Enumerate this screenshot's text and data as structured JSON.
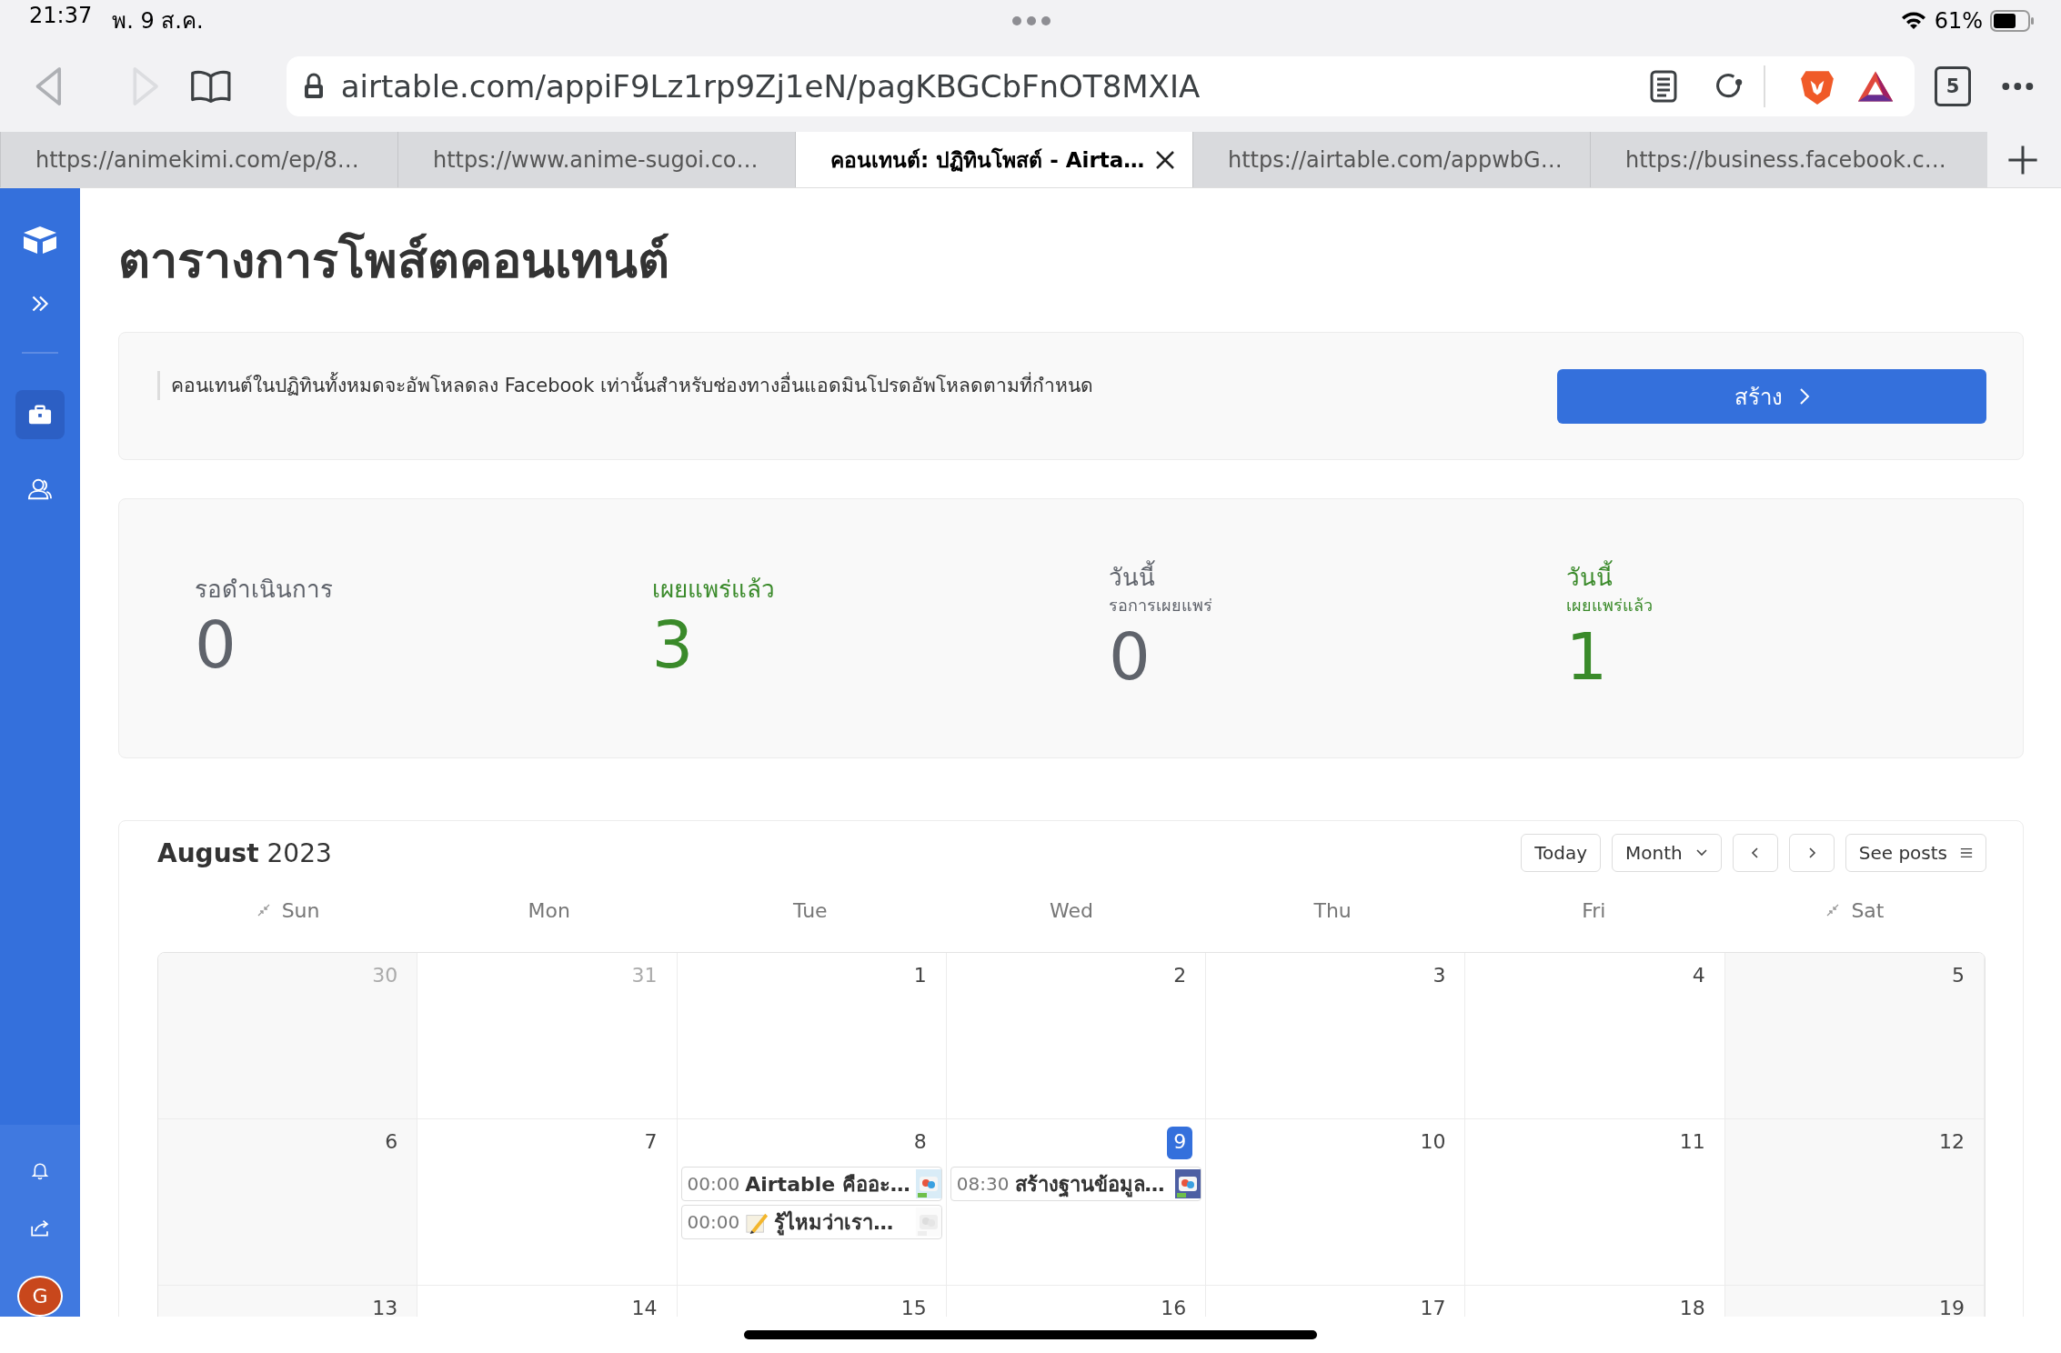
{
  "status_bar": {
    "time": "21:37",
    "date": "พ. 9 ส.ค.",
    "battery": "61%"
  },
  "browser": {
    "url": "airtable.com/appiF9Lz1rp9Zj1eN/pagKBGCbFnOT8MXIA",
    "back_disabled": false,
    "forward_disabled": true,
    "tab_count": "5",
    "tabs": [
      {
        "label": "https://animekimi.com/ep/8…",
        "selected": false
      },
      {
        "label": "https://www.anime-sugoi.co…",
        "selected": false
      },
      {
        "label": "คอนเทนต์: ปฏิทินโพสต์ - Airta…",
        "selected": true
      },
      {
        "label": "https://airtable.com/appwbG…",
        "selected": false
      },
      {
        "label": "https://business.facebook.c…",
        "selected": false
      }
    ]
  },
  "sidebar": {
    "items": [
      {
        "kind": "briefcase",
        "selected": true
      },
      {
        "kind": "people",
        "selected": false
      }
    ],
    "avatar": "G"
  },
  "page": {
    "title": "ตารางการโพส์ตคอนเทนต์",
    "notice": {
      "text": "คอนเทนต์ในปฏิทินทั้งหมดจะอัพโหลดลง Facebook เท่านั้นสำหรับช่องทางอื่นแอดมินโปรดอัพโหลดตามที่กำหนด",
      "button": "สร้าง"
    },
    "stats": [
      {
        "label": "รอดำเนินการ",
        "value": "0",
        "color": "#5f636b"
      },
      {
        "label": "เผยแพร่แล้ว",
        "value": "3",
        "color": "#3a8a2a"
      },
      {
        "label": "วันนี้",
        "sublabel": "รอการเผยแพร่",
        "value": "0",
        "color": "#5f636b"
      },
      {
        "label": "วันนี้",
        "sublabel": "เผยแพร่แล้ว",
        "value": "1",
        "color": "#3a8a2a"
      }
    ]
  },
  "calendar": {
    "month": "August",
    "year": "2023",
    "today_button": "Today",
    "view": "Month",
    "see_posts": "See posts",
    "weekdays": [
      {
        "label": "Sun",
        "weekend": true
      },
      {
        "label": "Mon",
        "weekend": false
      },
      {
        "label": "Tue",
        "weekend": false
      },
      {
        "label": "Wed",
        "weekend": false
      },
      {
        "label": "Thu",
        "weekend": false
      },
      {
        "label": "Fri",
        "weekend": false
      },
      {
        "label": "Sat",
        "weekend": true
      }
    ],
    "weeks": [
      [
        {
          "day": "30",
          "muted": true,
          "today": false
        },
        {
          "day": "31",
          "muted": true,
          "today": false
        },
        {
          "day": "1",
          "muted": false,
          "today": false
        },
        {
          "day": "2",
          "muted": false,
          "today": false
        },
        {
          "day": "3",
          "muted": false,
          "today": false
        },
        {
          "day": "4",
          "muted": false,
          "today": false
        },
        {
          "day": "5",
          "muted": false,
          "today": false
        }
      ],
      [
        {
          "day": "6",
          "muted": false,
          "today": false
        },
        {
          "day": "7",
          "muted": false,
          "today": false
        },
        {
          "day": "8",
          "muted": false,
          "today": false,
          "events": [
            {
              "time": "00:00",
              "title": "Airtable คืออะ…",
              "kind": "plain"
            },
            {
              "time": "00:00",
              "title": "รู้ไหมว่าเรา…",
              "kind": "note"
            }
          ]
        },
        {
          "day": "9",
          "muted": false,
          "today": true,
          "events": [
            {
              "time": "08:30",
              "title": "สร้างฐานข้อมูล…",
              "kind": "plain"
            }
          ]
        },
        {
          "day": "10",
          "muted": false,
          "today": false
        },
        {
          "day": "11",
          "muted": false,
          "today": false
        },
        {
          "day": "12",
          "muted": false,
          "today": false
        }
      ],
      [
        {
          "day": "13",
          "muted": false,
          "today": false
        },
        {
          "day": "14",
          "muted": false,
          "today": false
        },
        {
          "day": "15",
          "muted": false,
          "today": false
        },
        {
          "day": "16",
          "muted": false,
          "today": false
        },
        {
          "day": "17",
          "muted": false,
          "today": false
        },
        {
          "day": "18",
          "muted": false,
          "today": false
        },
        {
          "day": "19",
          "muted": false,
          "today": false
        }
      ]
    ]
  }
}
